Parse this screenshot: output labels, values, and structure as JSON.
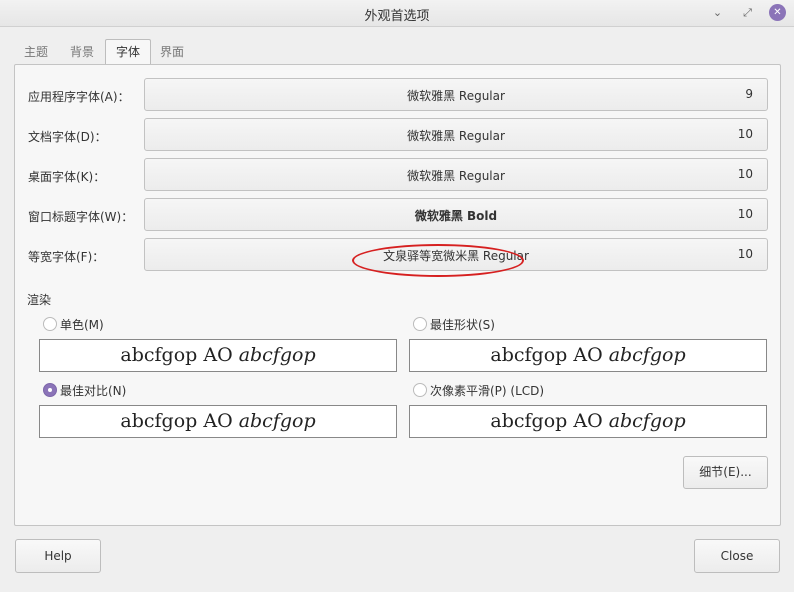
{
  "window": {
    "title": "外观首选项",
    "min_icon": "minimize-icon",
    "max_icon": "maximize-icon",
    "close_icon": "close-icon"
  },
  "tabs": [
    {
      "label": "主题",
      "active": false
    },
    {
      "label": "背景",
      "active": false
    },
    {
      "label": "字体",
      "active": true
    },
    {
      "label": "界面",
      "active": false
    }
  ],
  "fonts": [
    {
      "label": "应用程序字体(A)：",
      "font": "微软雅黑 Regular",
      "size": "9",
      "bold": false
    },
    {
      "label": "文档字体(D)：",
      "font": "微软雅黑 Regular",
      "size": "10",
      "bold": false
    },
    {
      "label": "桌面字体(K)：",
      "font": "微软雅黑 Regular",
      "size": "10",
      "bold": false
    },
    {
      "label": "窗口标题字体(W)：",
      "font": "微软雅黑 Bold",
      "size": "10",
      "bold": true
    },
    {
      "label": "等宽字体(F)：",
      "font": "文泉驿等宽微米黑 Regular",
      "size": "10",
      "bold": false
    }
  ],
  "rendering": {
    "title": "渲染",
    "options": [
      {
        "label": "单色(M)",
        "checked": false
      },
      {
        "label": "最佳形状(S)",
        "checked": false
      },
      {
        "label": "最佳对比(N)",
        "checked": true
      },
      {
        "label": "次像素平滑(P) (LCD)",
        "checked": false
      }
    ],
    "preview_regular": "abcfgop AO ",
    "preview_italic": "abcfgop"
  },
  "details_button": "细节(E)...",
  "help_button": "Help",
  "close_button": "Close",
  "colors": {
    "accent": "#8b74b8",
    "annotation": "#d62020"
  }
}
